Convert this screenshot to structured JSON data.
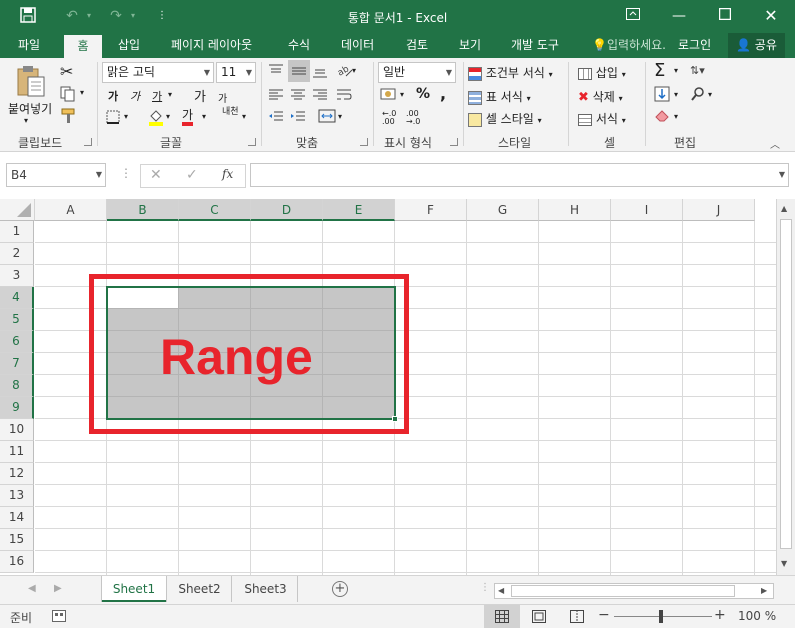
{
  "title": "통합 문서1 - Excel",
  "ribbon_tabs": [
    "파일",
    "홈",
    "삽입",
    "페이지 레이아웃",
    "수식",
    "데이터",
    "검토",
    "보기",
    "개발 도구"
  ],
  "tell_me": "입력하세요.",
  "login": "로그인",
  "share": "공유",
  "clipboard": {
    "paste": "붙여넣기",
    "label": "클립보드"
  },
  "font": {
    "name": "맑은 고딕",
    "size": "11",
    "label": "글꼴",
    "bold": "가",
    "italic": "가",
    "underline": "가",
    "grow": "가",
    "shrink": "가",
    "color_a": "가",
    "phonetic": "내천"
  },
  "align": {
    "label": "맞춤"
  },
  "number": {
    "format": "일반",
    "percent": "%",
    "comma": ",",
    "label": "표시 형식",
    "inc": "←.0\n.00",
    "dec": ".00\n→.0"
  },
  "styles": {
    "conditional": "조건부 서식",
    "table": "표 서식",
    "cell": "셀 스타일",
    "label": "스타일"
  },
  "cells": {
    "insert": "삽입",
    "delete": "삭제",
    "format": "서식",
    "label": "셀"
  },
  "editing": {
    "label": "편집"
  },
  "formula_bar": {
    "name_box": "B4",
    "fx": "fx",
    "value": ""
  },
  "columns": [
    "A",
    "B",
    "C",
    "D",
    "E",
    "F",
    "G",
    "H",
    "I",
    "J"
  ],
  "rows": [
    "1",
    "2",
    "3",
    "4",
    "5",
    "6",
    "7",
    "8",
    "9",
    "10",
    "11",
    "12",
    "13",
    "14",
    "15",
    "16"
  ],
  "overlay_text": "Range",
  "sheets": [
    "Sheet1",
    "Sheet2",
    "Sheet3"
  ],
  "status": {
    "ready": "준비",
    "zoom": "100 %"
  },
  "colors": {
    "excel_green": "#217346",
    "selection_gray": "#c6c6c6",
    "highlight_red": "#e8242c",
    "range_text": "#e8242c"
  }
}
